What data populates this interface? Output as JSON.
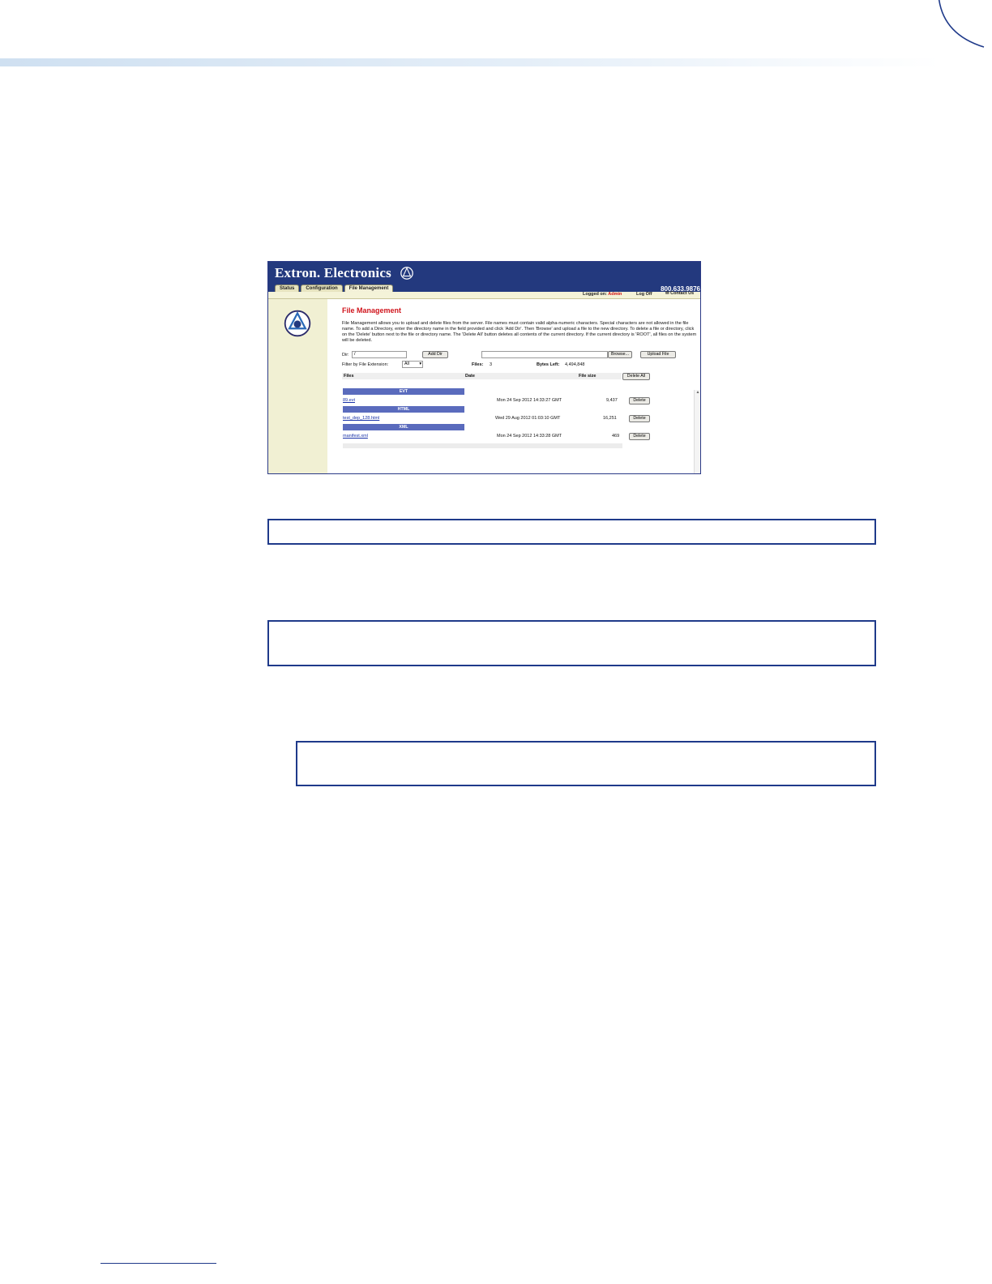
{
  "colors": {
    "accent_blue": "#23397e",
    "admin_red": "#d01010",
    "title_red": "#d0141c",
    "category_blue": "#5a6bbd"
  },
  "app": {
    "brand": "Extron. Electronics",
    "phone": "800.633.9876",
    "tabs": [
      "Status",
      "Configuration",
      "File Management"
    ],
    "active_tab": "File Management",
    "logged_on_label": "Logged on:",
    "logged_on_user": "Admin",
    "log_off": "Log Off",
    "contact_us": "Contact Us"
  },
  "page": {
    "title": "File Management",
    "description": "File Management allows you to upload and delete files from the server. File names must contain valid alpha-numeric characters. Special characters are not allowed in the file name. To add a Directory, enter the directory name in the field provided and click 'Add Dir'. Then 'Browse' and upload a file to the new directory. To delete a file or directory, click on the 'Delete' button next to the file or directory name. The 'Delete All' button deletes all contents of the current directory. If the current directory is 'ROOT', all files on the system will be deleted.",
    "dir_label": "Dir:",
    "dir_value": "/",
    "add_dir_button": "Add Dir",
    "browse_button": "Browse...",
    "upload_button": "Upload File",
    "filter_label": "Filter by File Extension:",
    "filter_value": "All",
    "files_label": "Files:",
    "files_count": "3",
    "bytes_left_label": "Bytes Left:",
    "bytes_left_value": "4,494,848",
    "columns": {
      "files": "Files",
      "date": "Date",
      "size": "File size"
    },
    "delete_all_button": "Delete All",
    "delete_button": "Delete",
    "groups": [
      {
        "category": "EVT",
        "file": "89.evt",
        "date": "Mon 24 Sep 2012 14:33:27 GMT",
        "size": "9,437"
      },
      {
        "category": "HTML",
        "file": "test_dep_128.html",
        "date": "Wed 29 Aug 2012 01:03:10 GMT",
        "size": "16,251"
      },
      {
        "category": "XML",
        "file": "manifest.xml",
        "date": "Mon 24 Sep 2012 14:33:28 GMT",
        "size": "469"
      }
    ]
  }
}
